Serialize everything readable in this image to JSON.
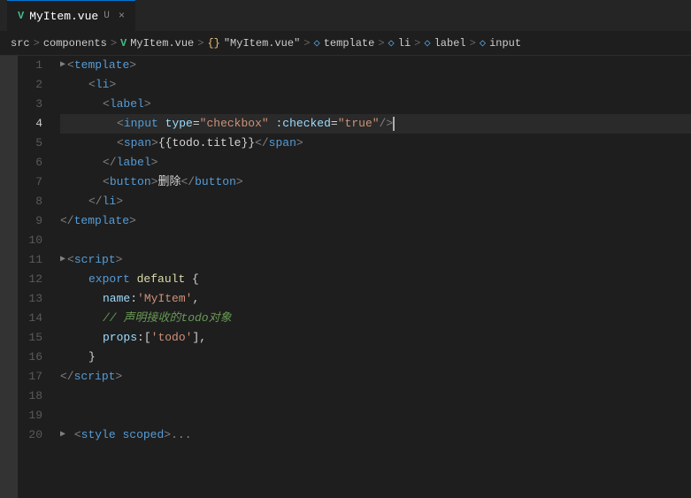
{
  "tab": {
    "icon": "V",
    "filename": "MyItem.vue",
    "modified": "U",
    "close": "×"
  },
  "breadcrumb": {
    "src": "src",
    "sep1": ">",
    "components": "components",
    "sep2": ">",
    "file": "MyItem.vue",
    "sep3": ">",
    "obj": "{}",
    "obj_title": "\"MyItem.vue\"",
    "sep4": ">",
    "template": "template",
    "sep5": ">",
    "li": "li",
    "sep6": ">",
    "label": "label",
    "sep7": ">",
    "input": "input"
  },
  "lines": [
    {
      "num": "1",
      "content": "template_open"
    },
    {
      "num": "2",
      "content": "li_open"
    },
    {
      "num": "3",
      "content": "label_open"
    },
    {
      "num": "4",
      "content": "input_line",
      "active": true
    },
    {
      "num": "5",
      "content": "span_line"
    },
    {
      "num": "6",
      "content": "label_close"
    },
    {
      "num": "7",
      "content": "button_line"
    },
    {
      "num": "8",
      "content": "li_close"
    },
    {
      "num": "9",
      "content": "template_close"
    },
    {
      "num": "10",
      "content": "empty"
    },
    {
      "num": "11",
      "content": "script_open"
    },
    {
      "num": "12",
      "content": "export_default"
    },
    {
      "num": "13",
      "content": "name_line"
    },
    {
      "num": "14",
      "content": "comment_line"
    },
    {
      "num": "15",
      "content": "props_line"
    },
    {
      "num": "16",
      "content": "close_brace"
    },
    {
      "num": "17",
      "content": "script_close"
    },
    {
      "num": "18",
      "content": "empty"
    },
    {
      "num": "19",
      "content": "empty"
    },
    {
      "num": "20",
      "content": "style_line"
    }
  ],
  "colors": {
    "bg": "#1e1e1e",
    "activeLine": "#2a2a2a",
    "lineNumActive": "#cccccc",
    "lineNum": "#5a5a5a",
    "accent": "#0078d4"
  }
}
